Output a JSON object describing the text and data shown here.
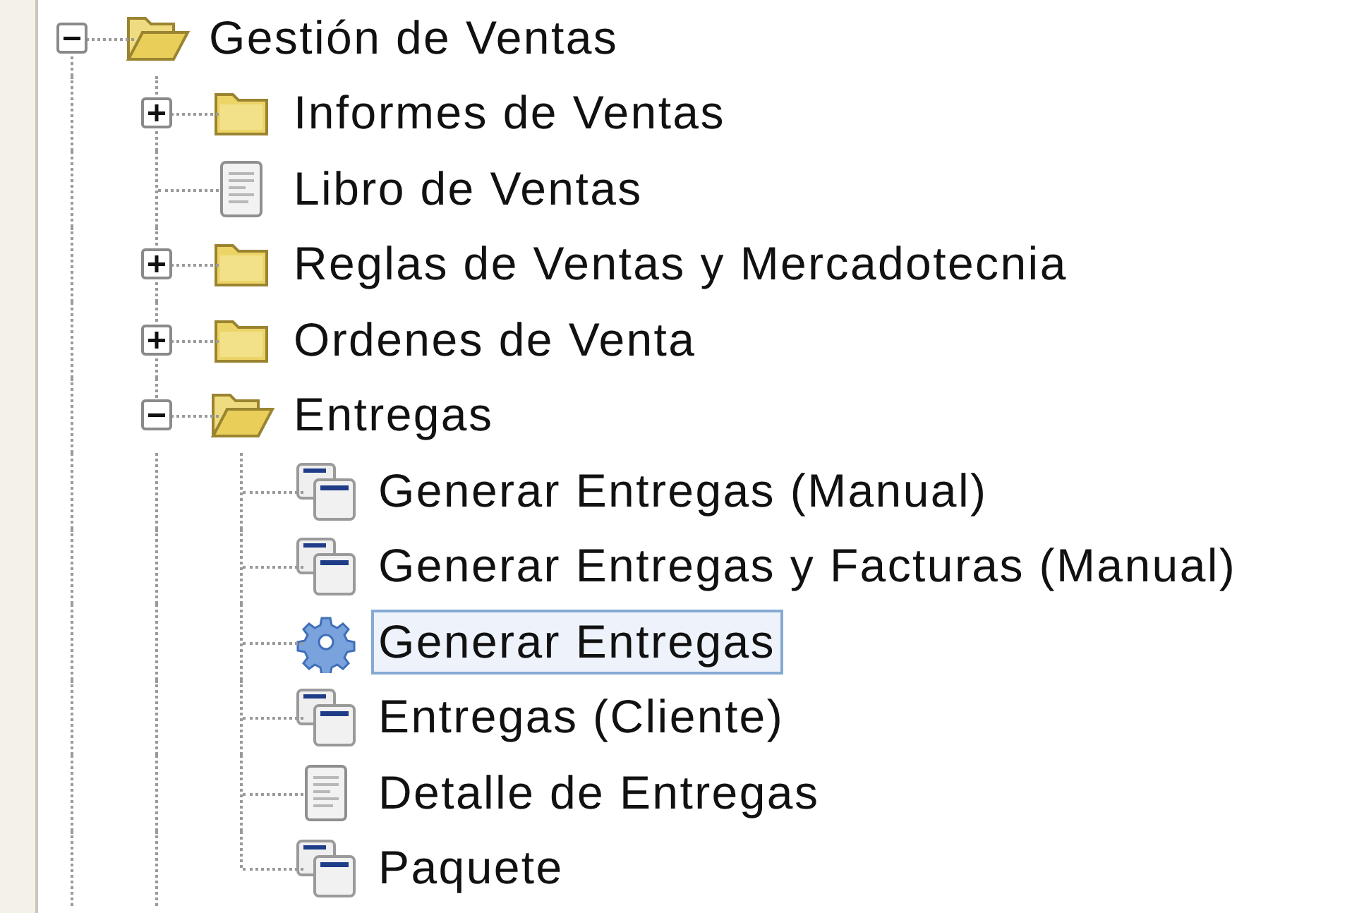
{
  "tree": [
    {
      "label": "Gestión de Ventas",
      "kind": "folder",
      "expanded": true,
      "selected": false,
      "children": [
        {
          "label": "Informes de Ventas",
          "kind": "folder",
          "expanded": false,
          "selected": false
        },
        {
          "label": "Libro de Ventas",
          "kind": "report",
          "selected": false
        },
        {
          "label": "Reglas de Ventas y Mercadotecnia",
          "kind": "folder",
          "expanded": false,
          "selected": false
        },
        {
          "label": "Ordenes de Venta",
          "kind": "folder",
          "expanded": false,
          "selected": false
        },
        {
          "label": "Entregas",
          "kind": "folder",
          "expanded": true,
          "selected": false,
          "children": [
            {
              "label": "Generar Entregas (Manual)",
              "kind": "window",
              "selected": false
            },
            {
              "label": "Generar Entregas y Facturas (Manual)",
              "kind": "window",
              "selected": false
            },
            {
              "label": "Generar Entregas",
              "kind": "process",
              "selected": true
            },
            {
              "label": "Entregas (Cliente)",
              "kind": "window",
              "selected": false
            },
            {
              "label": "Detalle de Entregas",
              "kind": "report",
              "selected": false
            },
            {
              "label": "Paquete",
              "kind": "window",
              "selected": false
            }
          ]
        }
      ]
    }
  ]
}
